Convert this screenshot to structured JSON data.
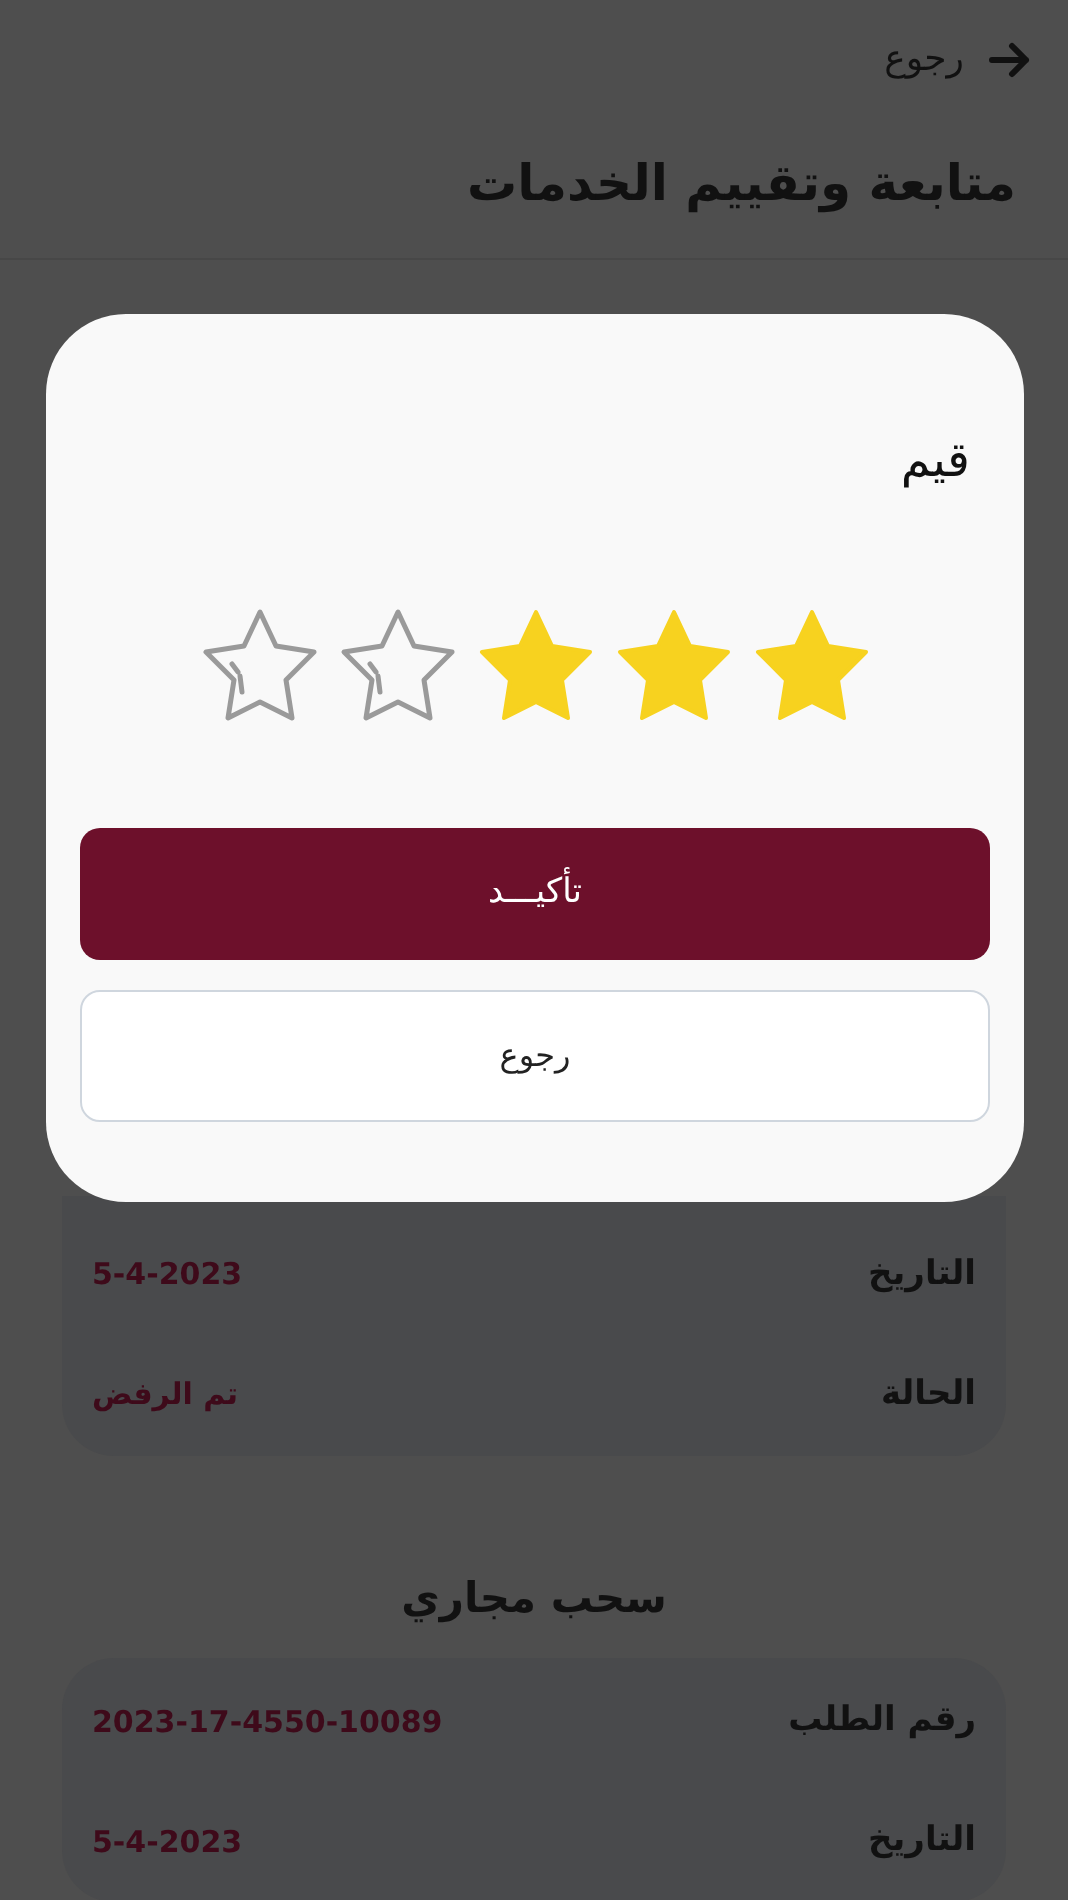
{
  "header": {
    "back": "رجوع",
    "title": "متابعة وتقييم الخدمات"
  },
  "cards": [
    {
      "rows": [
        {
          "label": "التاريخ",
          "value": "5-4-2023"
        },
        {
          "label": "الحالة",
          "value": "تم الرفض"
        }
      ]
    },
    {
      "title": "سحب مجاري",
      "rows": [
        {
          "label": "رقم الطلب",
          "value": "2023-17-4550-10089"
        },
        {
          "label": "التاريخ",
          "value": "5-4-2023"
        }
      ]
    }
  ],
  "dialog": {
    "title": "قيم",
    "stars": 3,
    "confirm": "تأكيـــد",
    "cancel": "رجوع"
  }
}
